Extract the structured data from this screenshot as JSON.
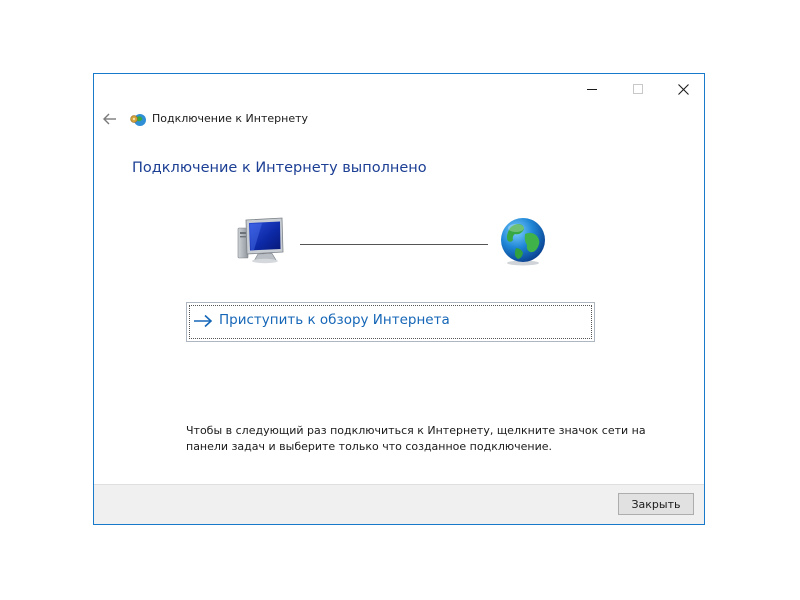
{
  "window": {
    "title": "Подключение к Интернету",
    "accent_color": "#1979ca",
    "controls": {
      "minimize_icon": "minimize-icon",
      "maximize_icon": "maximize-icon",
      "close_icon": "close-icon"
    }
  },
  "nav": {
    "back_icon": "back-arrow-icon",
    "title_icon": "network-connection-icon",
    "title": "Подключение к Интернету"
  },
  "main": {
    "heading": "Подключение к Интернету выполнено",
    "heading_color": "#1c3f94",
    "illustration": {
      "left_icon": "computer-icon",
      "right_icon": "globe-icon"
    },
    "browse_link": {
      "icon": "arrow-right-icon",
      "label": "Приступить к обзору Интернета",
      "color": "#1566b7"
    },
    "hint": "Чтобы в следующий раз подключиться к Интернету, щелкните значок сети на панели задач и выберите только что созданное подключение."
  },
  "footer": {
    "close_label": "Закрыть"
  }
}
